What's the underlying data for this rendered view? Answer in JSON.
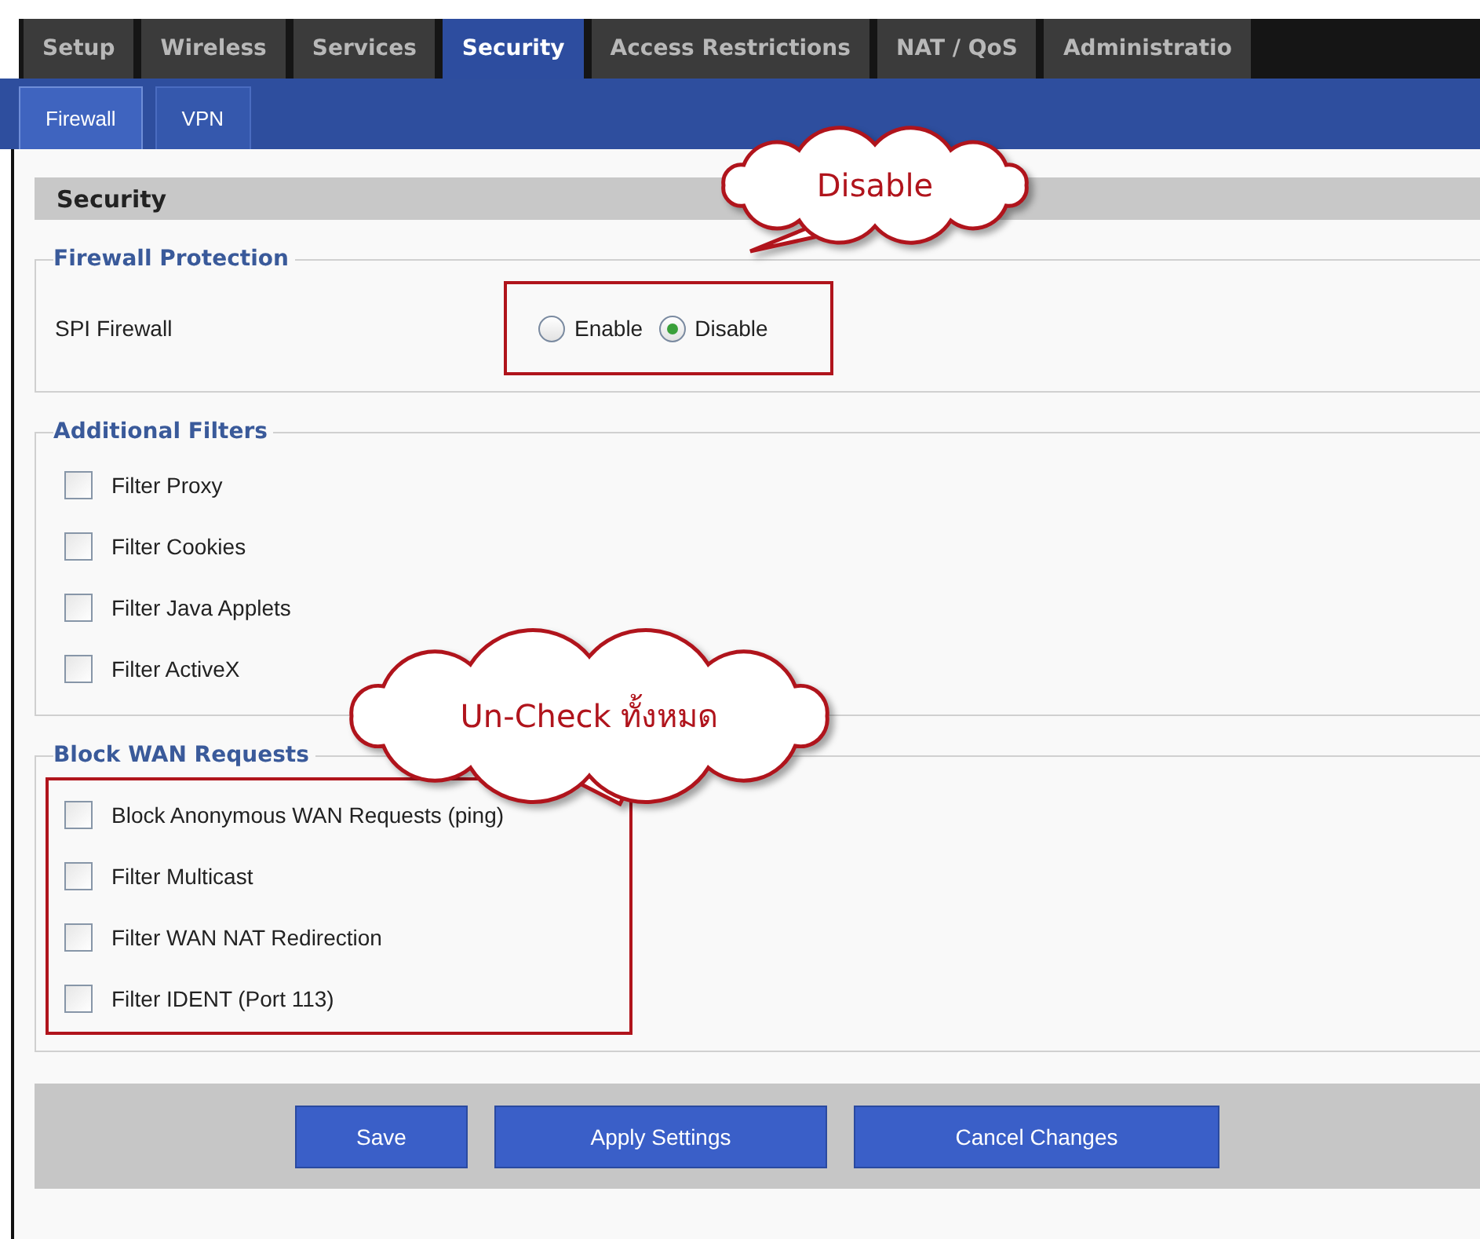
{
  "tabs": [
    {
      "label": "Setup",
      "selected": false
    },
    {
      "label": "Wireless",
      "selected": false
    },
    {
      "label": "Services",
      "selected": false
    },
    {
      "label": "Security",
      "selected": true
    },
    {
      "label": "Access Restrictions",
      "selected": false
    },
    {
      "label": "NAT / QoS",
      "selected": false
    },
    {
      "label": "Administratio",
      "selected": false
    }
  ],
  "subtabs": [
    {
      "label": "Firewall",
      "selected": true
    },
    {
      "label": "VPN",
      "selected": false
    }
  ],
  "section_title": "Security",
  "groups": [
    {
      "legend": "Firewall Protection",
      "highlighted": false,
      "rows": [
        {
          "kind": "radio",
          "label": "SPI Firewall",
          "highlighted": true,
          "options": [
            {
              "label": "Enable",
              "selected": false
            },
            {
              "label": "Disable",
              "selected": true
            }
          ]
        }
      ]
    },
    {
      "legend": "Additional Filters",
      "highlighted": false,
      "rows": [
        {
          "kind": "checkbox",
          "label": "Filter Proxy",
          "checked": false
        },
        {
          "kind": "checkbox",
          "label": "Filter Cookies",
          "checked": false
        },
        {
          "kind": "checkbox",
          "label": "Filter Java Applets",
          "checked": false
        },
        {
          "kind": "checkbox",
          "label": "Filter ActiveX",
          "checked": false
        }
      ]
    },
    {
      "legend": "Block WAN Requests",
      "highlighted": true,
      "rows": [
        {
          "kind": "checkbox",
          "label": "Block Anonymous WAN Requests (ping)",
          "checked": false
        },
        {
          "kind": "checkbox",
          "label": "Filter Multicast",
          "checked": false
        },
        {
          "kind": "checkbox",
          "label": "Filter WAN NAT Redirection",
          "checked": false
        },
        {
          "kind": "checkbox",
          "label": "Filter IDENT (Port 113)",
          "checked": false
        }
      ]
    }
  ],
  "buttons": [
    "Save",
    "Apply Settings",
    "Cancel Changes"
  ],
  "callouts": [
    "Disable",
    "Un-Check ทั้งหมด"
  ]
}
